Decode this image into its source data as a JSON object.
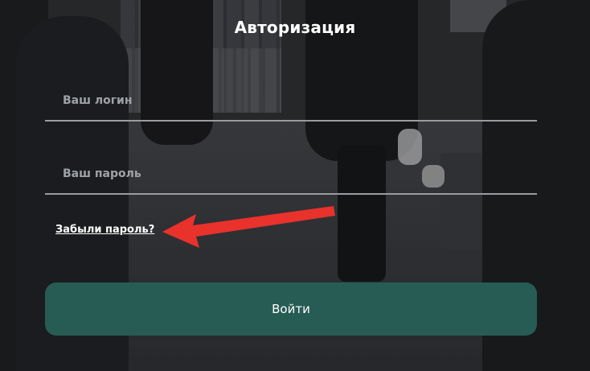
{
  "form": {
    "title": "Авторизация",
    "login_placeholder": "Ваш логин",
    "password_placeholder": "Ваш пароль",
    "forgot_link": "Забыли пароль?",
    "submit_label": "Войти"
  },
  "colors": {
    "submit_bg": "#275c55",
    "annotation_arrow": "#e8322b"
  },
  "icons": {
    "annotation": "arrow-pointer-icon"
  }
}
